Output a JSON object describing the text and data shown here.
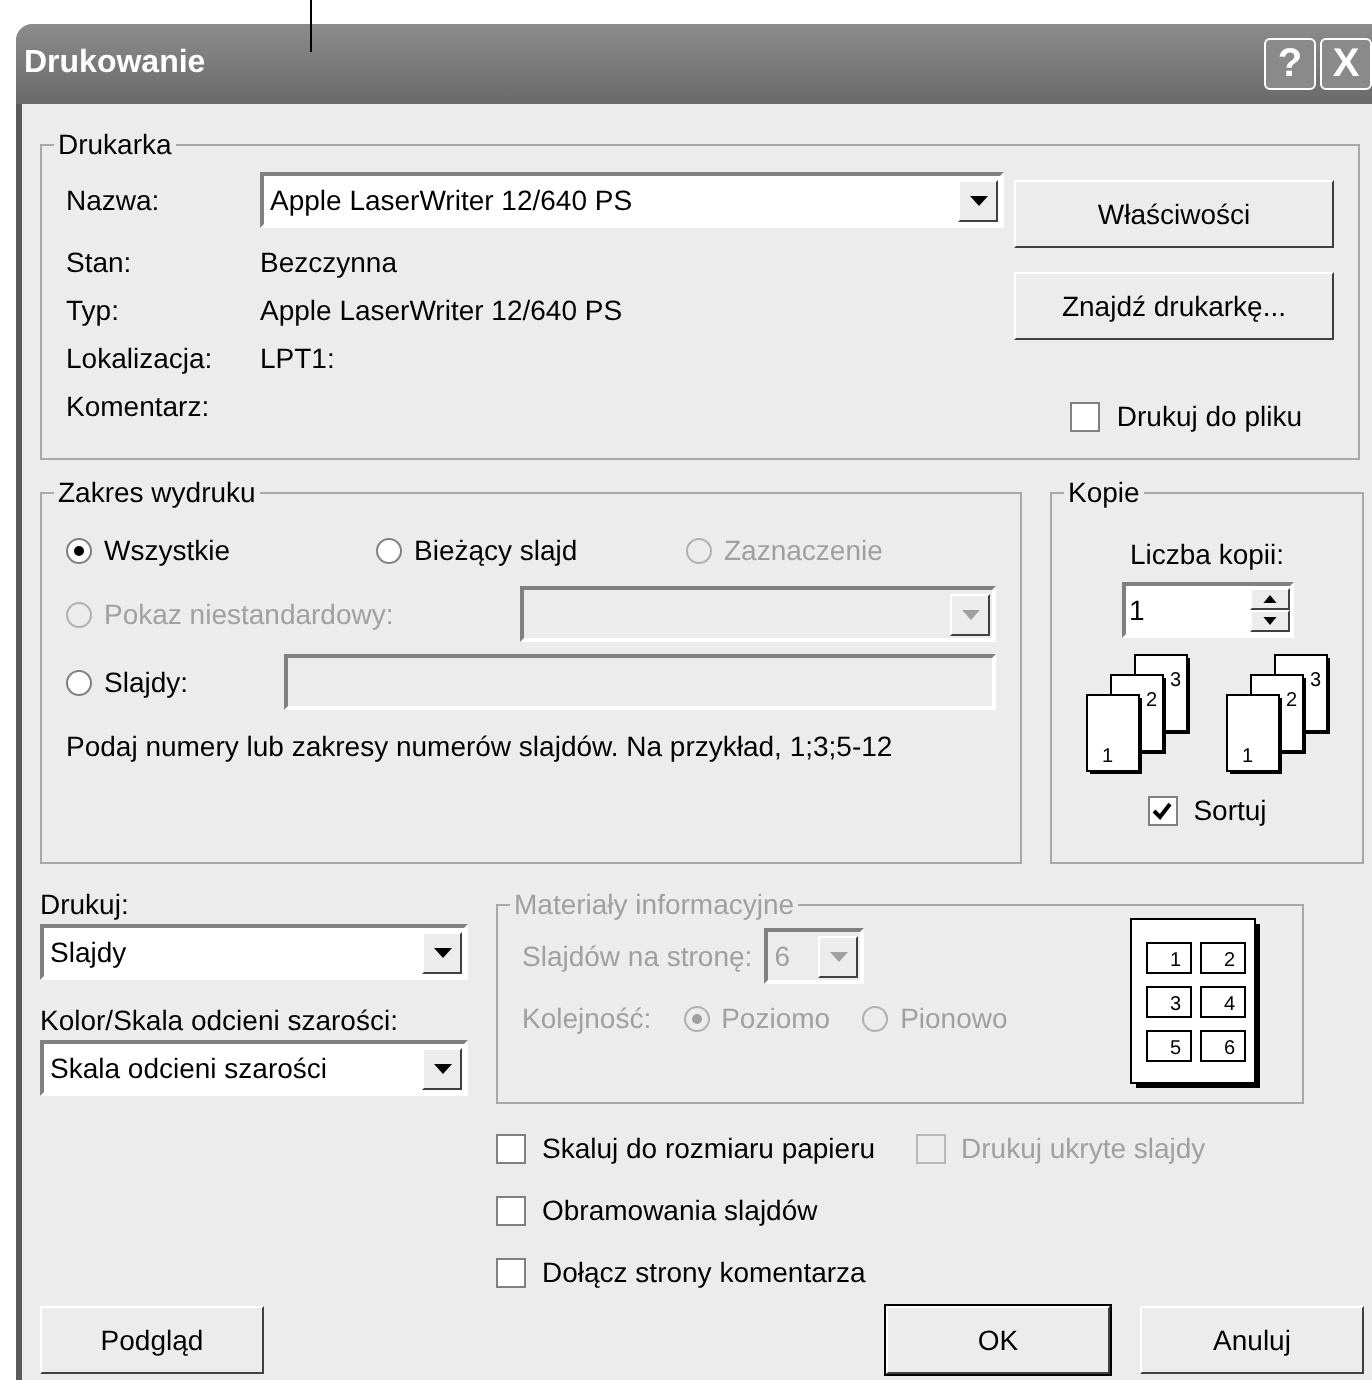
{
  "window": {
    "title": "Drukowanie",
    "buttons": [
      "?",
      "X"
    ]
  },
  "printer": {
    "title": "Drukarka",
    "name_label": "Nazwa:",
    "name_value": "Apple LaserWriter 12/640 PS",
    "info": [
      {
        "label": "Stan:",
        "value": "Bezczynna"
      },
      {
        "label": "Typ:",
        "value": "Apple LaserWriter 12/640 PS"
      },
      {
        "label": "Lokalizacja:",
        "value": "LPT1:"
      },
      {
        "label": "Komentarz:"
      }
    ],
    "buttons": [
      "Właściwości",
      "Znajdź drukarkę..."
    ],
    "print_to_file": {
      "label": "Drukuj do pliku",
      "checked": false
    }
  },
  "range": {
    "title": "Zakres wydruku",
    "options": [
      {
        "label": "Wszystkie",
        "selected": true,
        "disabled": false
      },
      {
        "label": "Bieżący slajd",
        "selected": false,
        "disabled": false
      },
      {
        "label": "Zaznaczenie",
        "selected": false,
        "disabled": true
      }
    ],
    "custom_show": {
      "label": "Pokaz niestandardowy:",
      "selected": false,
      "disabled": true
    },
    "slides": {
      "label": "Slajdy:",
      "selected": false,
      "disabled": false
    },
    "hint": "Podaj numery lub zakresy numerów slajdów. Na przykład, 1;3;5-12"
  },
  "copies": {
    "title": "Kopie",
    "count_label": "Liczba kopii:",
    "count": "1",
    "stacks": [
      [
        "1",
        "2",
        "3"
      ],
      [
        "1",
        "2",
        "3"
      ]
    ],
    "collate": {
      "label": "Sortuj",
      "checked": true
    }
  },
  "print_what": {
    "label": "Drukuj:",
    "value": "Slajdy"
  },
  "color": {
    "label": "Kolor/Skala odcieni szarości:",
    "value": "Skala odcieni szarości"
  },
  "handouts": {
    "title": "Materiały informacyjne",
    "disabled": true,
    "per_page_label": "Slajdów na stronę:",
    "per_page": "6",
    "order_label": "Kolejność:",
    "order": [
      {
        "label": "Poziomo",
        "selected": true
      },
      {
        "label": "Pionowo",
        "selected": false
      }
    ],
    "preview": [
      "1",
      "2",
      "3",
      "4",
      "5",
      "6"
    ]
  },
  "options": [
    {
      "label": "Skaluj do rozmiaru papieru",
      "checked": false,
      "disabled": false
    },
    {
      "label": "Drukuj ukryte slajdy",
      "checked": false,
      "disabled": true
    },
    {
      "label": "Obramowania slajdów",
      "checked": false,
      "disabled": false
    },
    {
      "label": "Dołącz strony komentarza",
      "checked": false,
      "disabled": false
    }
  ],
  "footer": [
    {
      "label": "Podgląd",
      "default": false
    },
    {
      "label": "OK",
      "default": true
    },
    {
      "label": "Anuluj",
      "default": false
    }
  ]
}
